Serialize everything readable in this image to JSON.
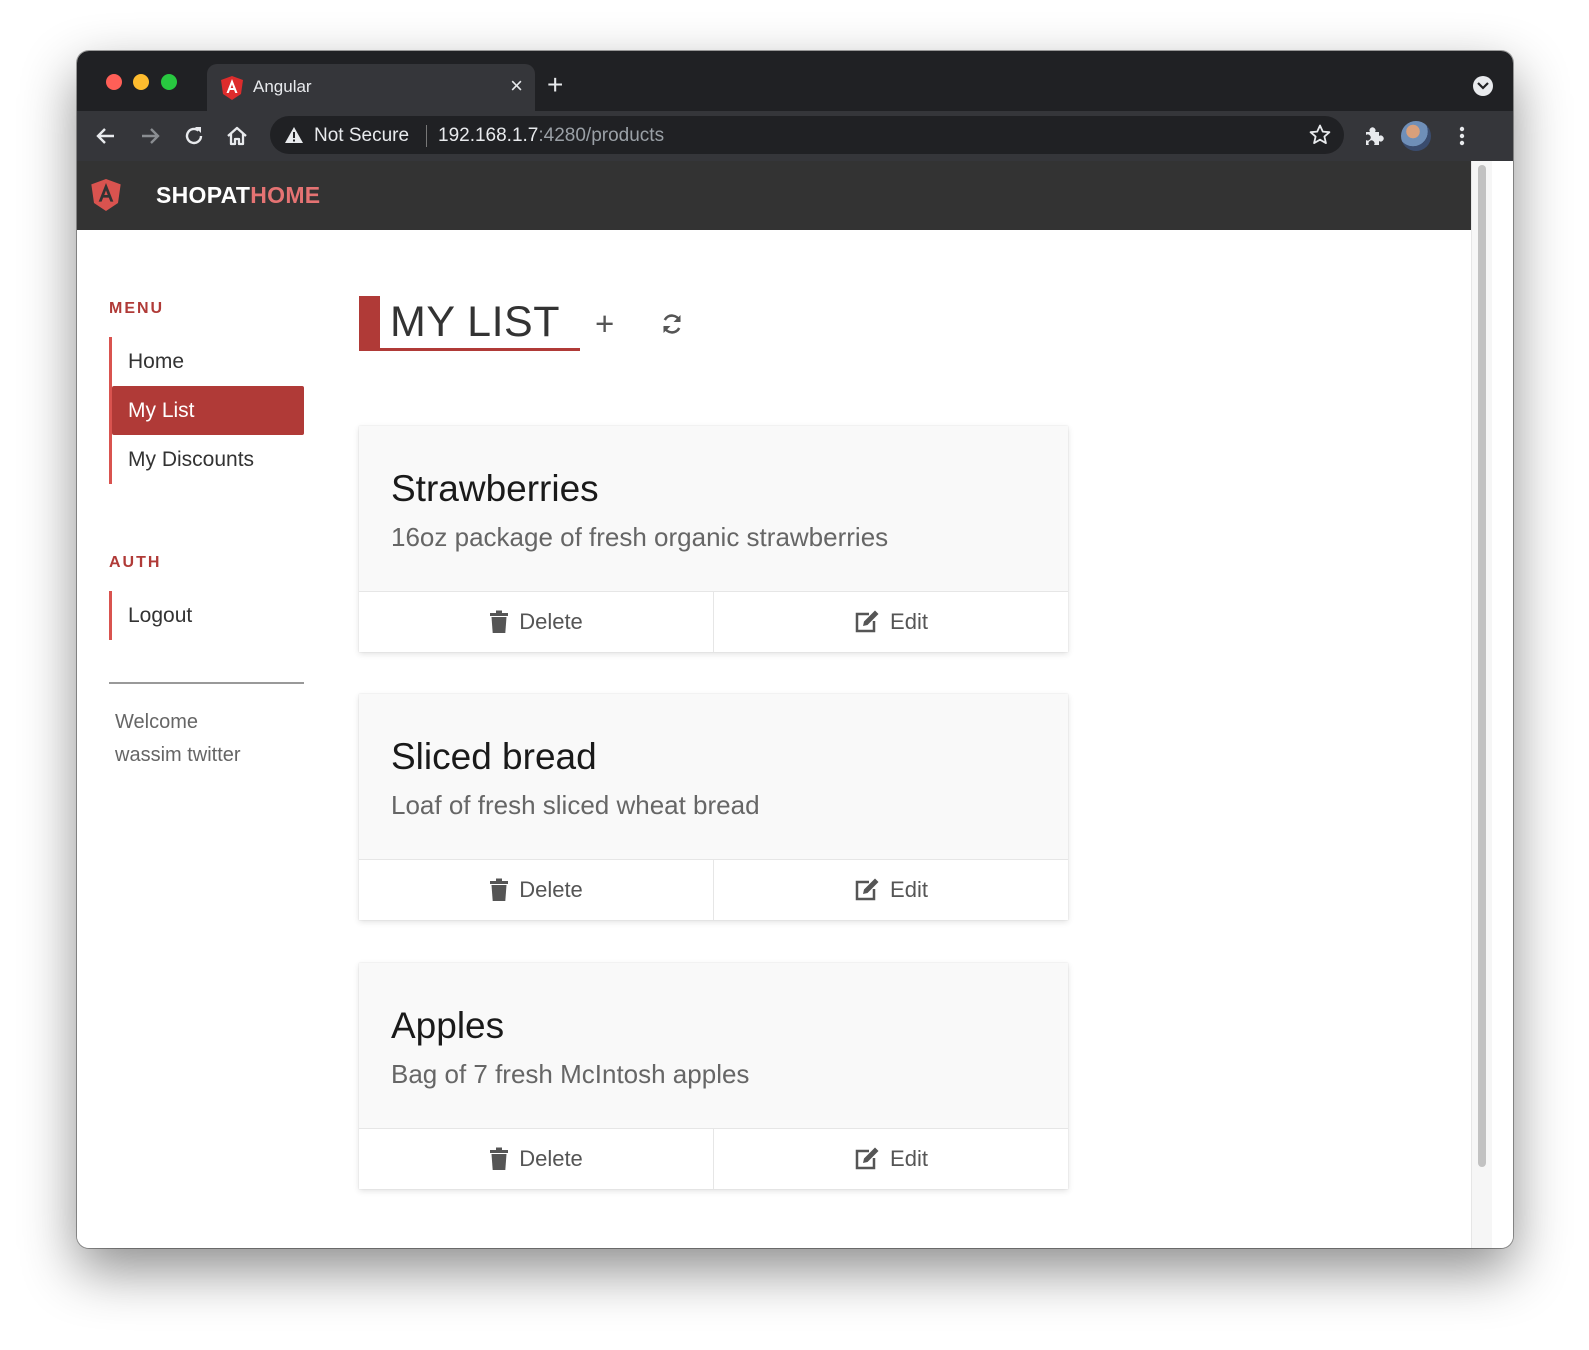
{
  "browser": {
    "tab_title": "Angular",
    "tab_close": "×",
    "new_tab": "+",
    "security_label": "Not Secure",
    "url_host": "192.168.1.7",
    "url_rest": ":4280/products"
  },
  "app": {
    "brand_part1": "SHOPAT",
    "brand_part2": "HOME",
    "accent_color": "#b03a37",
    "brand_highlight_color": "#e57373"
  },
  "sidebar": {
    "menu_heading": "MENU",
    "menu_items": [
      {
        "label": "Home",
        "active": false
      },
      {
        "label": "My List",
        "active": true
      },
      {
        "label": "My Discounts",
        "active": false
      }
    ],
    "auth_heading": "AUTH",
    "auth_items": [
      {
        "label": "Logout"
      }
    ],
    "welcome_text": "Welcome wassim twitter"
  },
  "main": {
    "title": "MY LIST",
    "add_label": "+",
    "products": [
      {
        "name": "Strawberries",
        "description": "16oz package of fresh organic strawberries",
        "delete_label": "Delete",
        "edit_label": "Edit"
      },
      {
        "name": "Sliced bread",
        "description": "Loaf of fresh sliced wheat bread",
        "delete_label": "Delete",
        "edit_label": "Edit"
      },
      {
        "name": "Apples",
        "description": "Bag of 7 fresh McIntosh apples",
        "delete_label": "Delete",
        "edit_label": "Edit"
      }
    ]
  }
}
